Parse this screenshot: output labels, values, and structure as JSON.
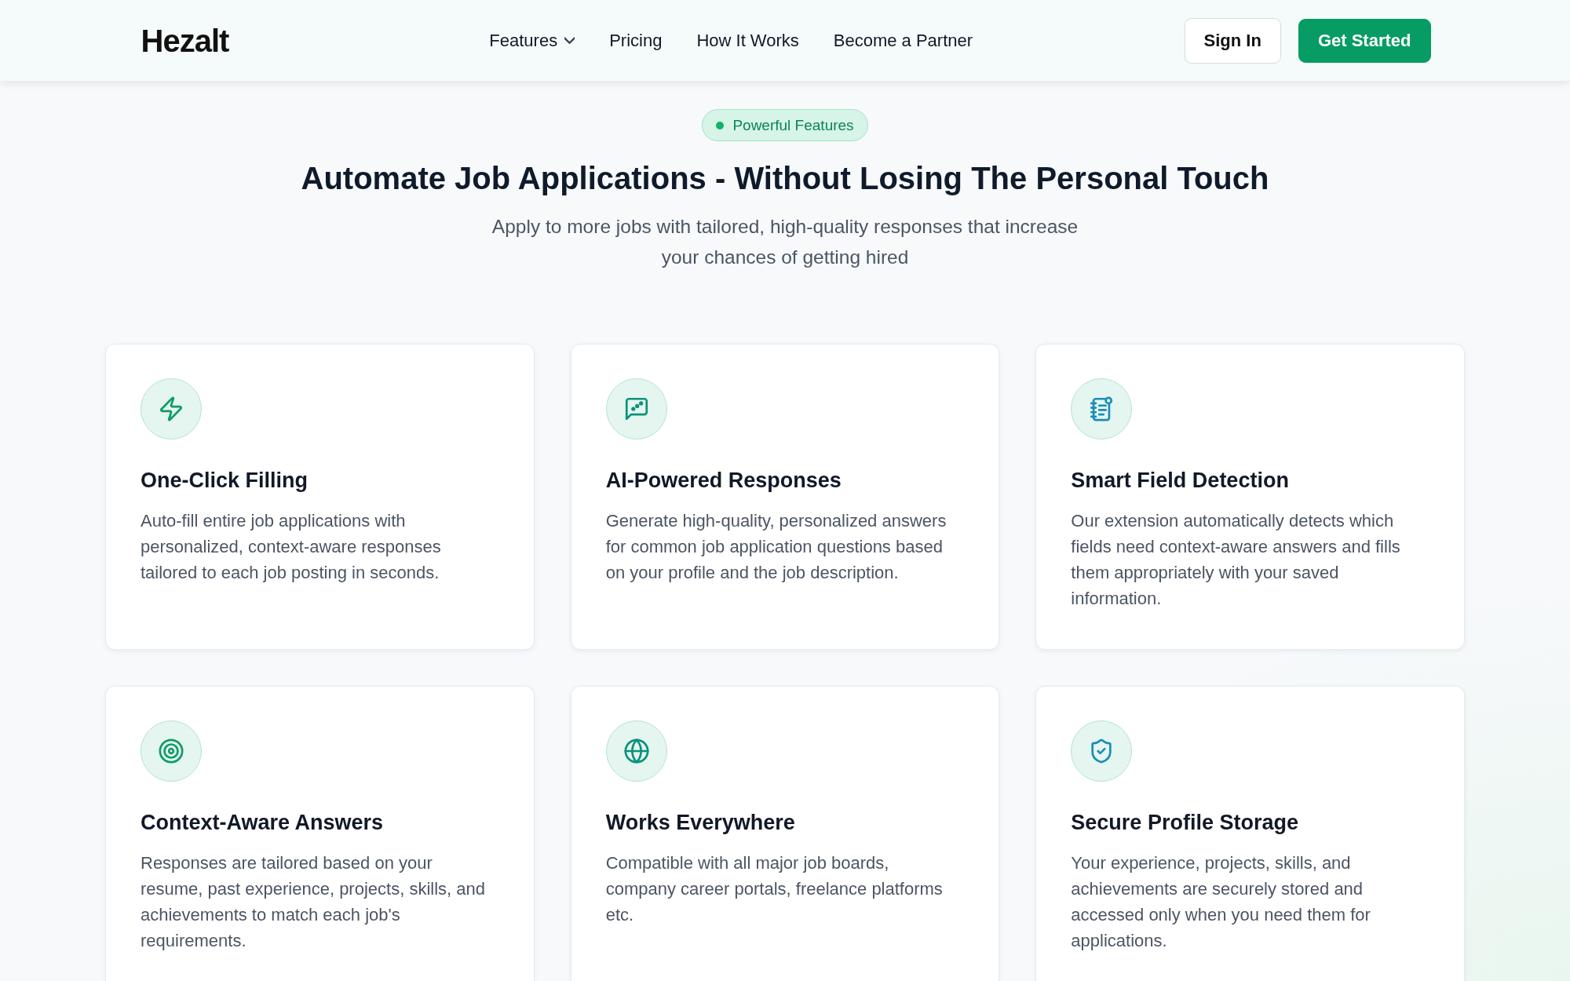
{
  "header": {
    "logo": "Hezalt",
    "nav": [
      {
        "label": "Features",
        "kind": "dropdown"
      },
      {
        "label": "Pricing",
        "kind": "link"
      },
      {
        "label": "How It Works",
        "kind": "link"
      },
      {
        "label": "Become a Partner",
        "kind": "link"
      }
    ],
    "actions": [
      {
        "label": "Sign In",
        "kind": "outline"
      },
      {
        "label": "Get Started",
        "kind": "primary"
      }
    ]
  },
  "hero": {
    "badge": "Powerful Features",
    "title": "Automate Job Applications - Without Losing The Personal Touch",
    "subtitle": "Apply to more jobs with tailored, high-quality responses that increase your chances of getting hired"
  },
  "features": [
    {
      "title": "One-Click Filling",
      "description": "Auto-fill entire job applications with personalized, context-aware responses tailored to each job posting in seconds."
    },
    {
      "title": "AI-Powered Responses",
      "description": "Generate high-quality, personalized answers for common job application questions based on your profile and the job description."
    },
    {
      "title": "Smart Field Detection",
      "description": "Our extension automatically detects which fields need context-aware answers and fills them appropriately with your saved information."
    },
    {
      "title": "Context-Aware Answers",
      "description": "Responses are tailored based on your resume, past experience, projects, skills, and achievements to match each job's requirements."
    },
    {
      "title": "Works Everywhere",
      "description": "Compatible with all major job boards, company career portals, freelance platforms etc."
    },
    {
      "title": "Secure Profile Storage",
      "description": "Your experience, projects, skills, and achievements are securely stored and accessed only when you need them for applications."
    }
  ]
}
